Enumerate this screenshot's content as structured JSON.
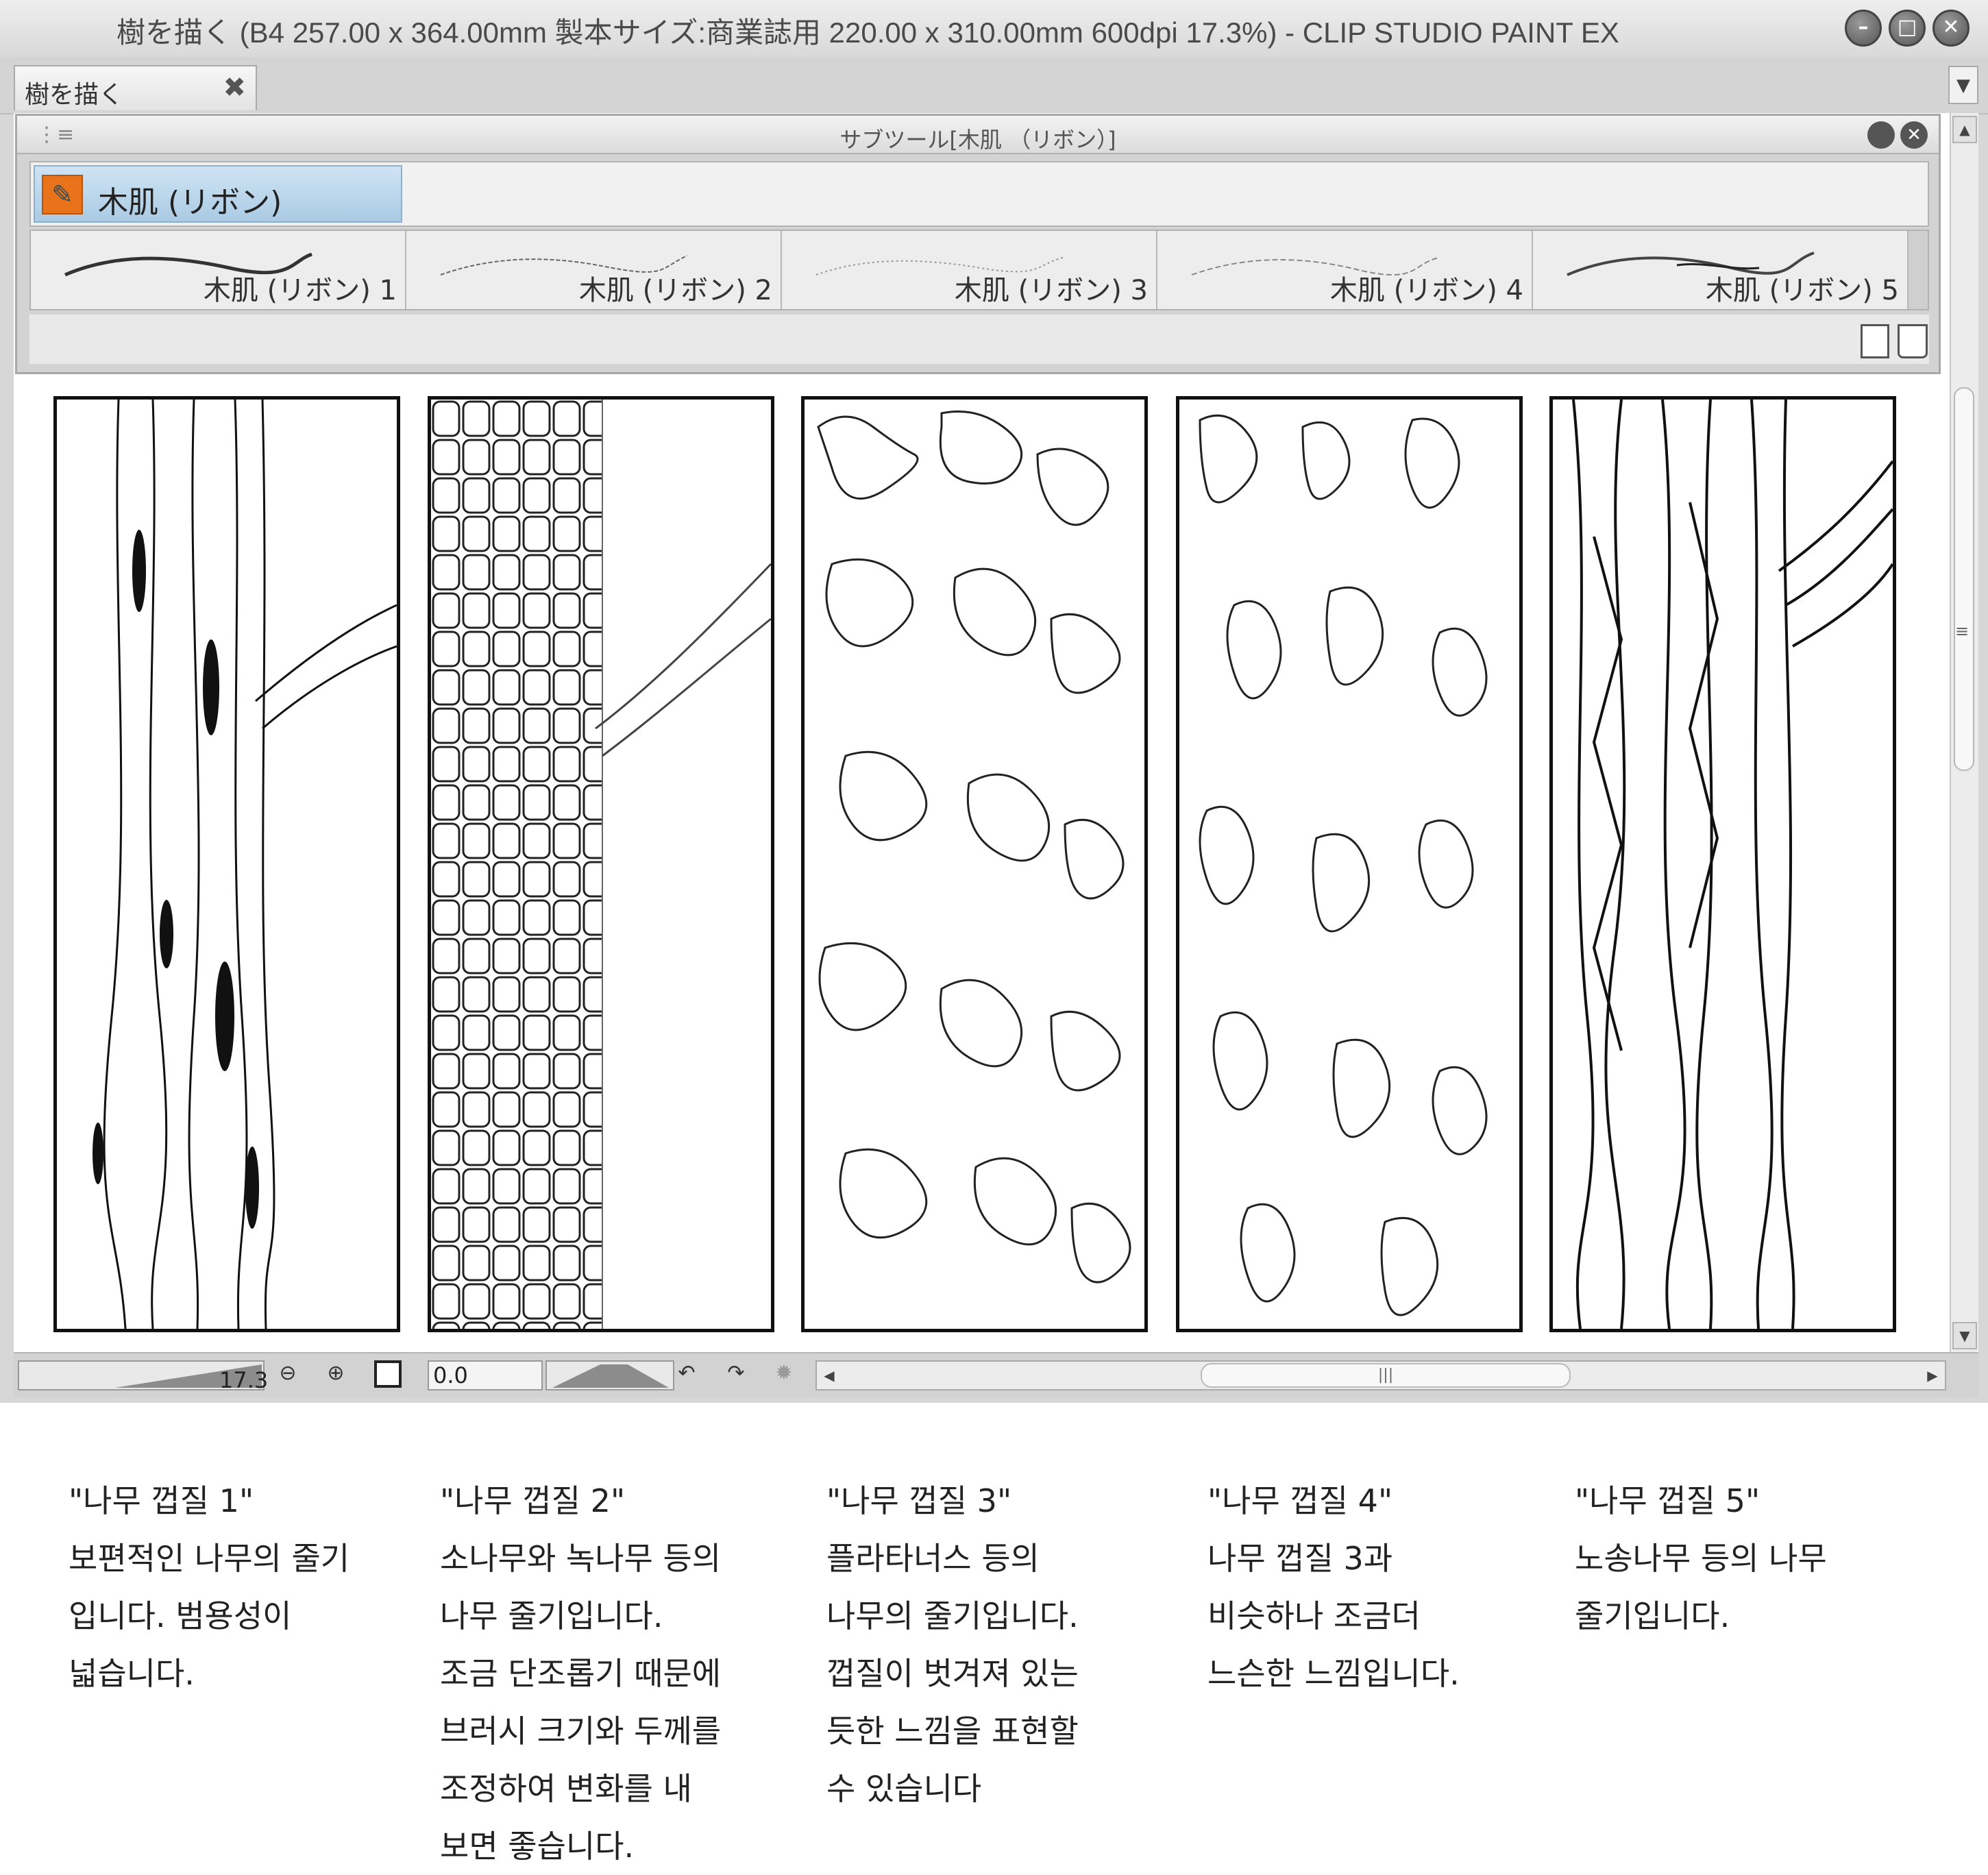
{
  "window": {
    "title": "樹を描く (B4 257.00 x 364.00mm 製本サイズ:商業誌用 220.00 x 310.00mm 600dpi 17.3%)  - CLIP STUDIO PAINT EX",
    "tab_label": "樹を描く",
    "tab_close": "✖"
  },
  "palette": {
    "title": "サブツール[木肌 （リボン）]",
    "group_label": "木肌 (リボン)",
    "brushes": [
      {
        "label": "木肌 (リボン) 1"
      },
      {
        "label": "木肌 (リボン) 2"
      },
      {
        "label": "木肌 (リボン) 3"
      },
      {
        "label": "木肌 (リボン) 4"
      },
      {
        "label": "木肌 (リボン) 5"
      }
    ]
  },
  "statusbar": {
    "zoom": "17.3",
    "rotation": "0.0"
  },
  "captions": [
    {
      "title": "\"나무 껍질 1\"",
      "lines": [
        "보편적인 나무의 줄기",
        "입니다. 범용성이",
        "넓습니다."
      ]
    },
    {
      "title": "\"나무 껍질 2\"",
      "lines": [
        "소나무와 녹나무 등의",
        "나무 줄기입니다.",
        "조금 단조롭기 때문에",
        "브러시 크기와 두께를",
        "조정하여 변화를 내",
        "보면 좋습니다."
      ]
    },
    {
      "title": "\"나무 껍질 3\"",
      "lines": [
        "플라타너스 등의",
        "나무의 줄기입니다.",
        "껍질이 벗겨져 있는",
        "듯한 느낌을 표현할",
        "수 있습니다"
      ]
    },
    {
      "title": "\"나무 껍질 4\"",
      "lines": [
        "나무 껍질 3과",
        "비슷하나 조금더",
        "느슨한 느낌입니다."
      ]
    },
    {
      "title": "\"나무 껍질 5\"",
      "lines": [
        "노송나무 등의 나무",
        "줄기입니다."
      ]
    }
  ],
  "colors": {
    "tool_icon": "#e8731a",
    "group_tab": "#bcd6ec"
  },
  "icons": {
    "zoom_out": "zoom-out-icon",
    "zoom_in": "zoom-in-icon",
    "fit": "fit-screen-icon",
    "rotate_left": "rotate-left-icon",
    "rotate_right": "rotate-right-icon",
    "reset": "reset-rotation-icon"
  }
}
